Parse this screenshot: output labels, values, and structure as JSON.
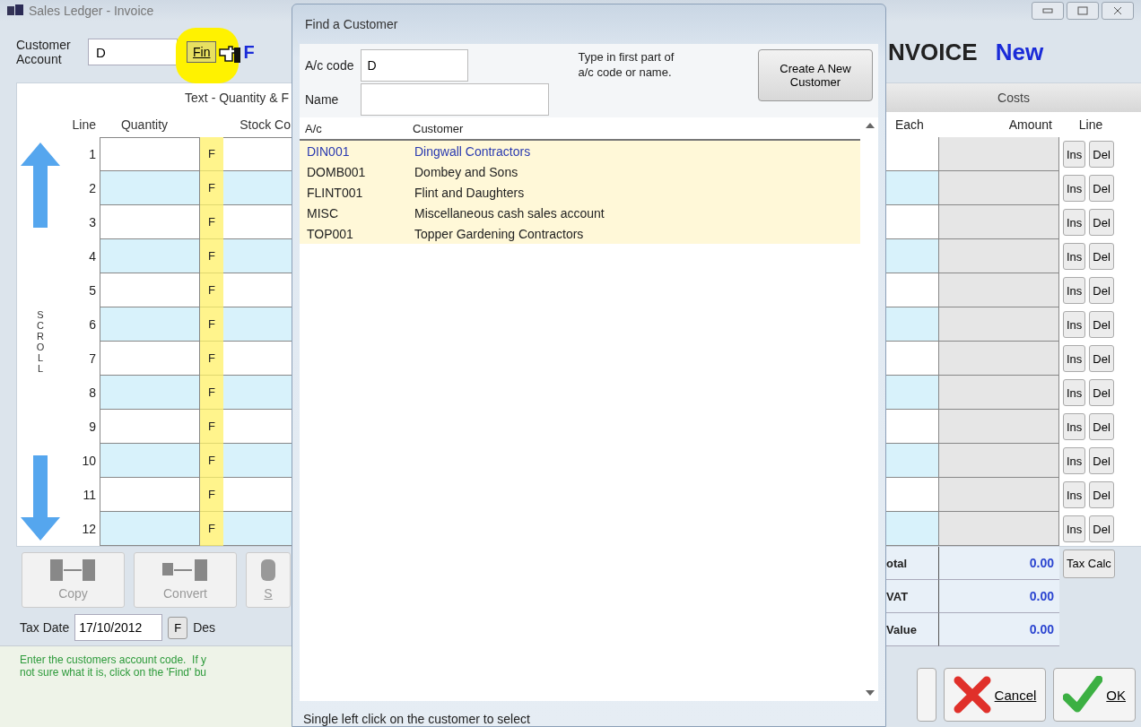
{
  "window": {
    "title": "Sales Ledger - Invoice"
  },
  "header": {
    "account_label": "Customer Account",
    "account_value": "D",
    "find_button": "Fin",
    "find_highlighted": true,
    "cut_label": "F",
    "doc_title": "NVOICE",
    "doc_status": "New"
  },
  "lines_panel": {
    "heading": "Text - Quantity & F",
    "columns": [
      "Line",
      "Quantity",
      "Stock Co"
    ],
    "scroll_label": "SCROLL"
  },
  "costs_panel": {
    "heading": "Costs",
    "columns": [
      "Each",
      "Amount",
      "Line"
    ]
  },
  "rows": [
    {
      "line": "1",
      "find": "F",
      "ins": "Ins",
      "del": "Del"
    },
    {
      "line": "2",
      "find": "F",
      "ins": "Ins",
      "del": "Del"
    },
    {
      "line": "3",
      "find": "F",
      "ins": "Ins",
      "del": "Del"
    },
    {
      "line": "4",
      "find": "F",
      "ins": "Ins",
      "del": "Del"
    },
    {
      "line": "5",
      "find": "F",
      "ins": "Ins",
      "del": "Del"
    },
    {
      "line": "6",
      "find": "F",
      "ins": "Ins",
      "del": "Del"
    },
    {
      "line": "7",
      "find": "F",
      "ins": "Ins",
      "del": "Del"
    },
    {
      "line": "8",
      "find": "F",
      "ins": "Ins",
      "del": "Del"
    },
    {
      "line": "9",
      "find": "F",
      "ins": "Ins",
      "del": "Del"
    },
    {
      "line": "10",
      "find": "F",
      "ins": "Ins",
      "del": "Del"
    },
    {
      "line": "11",
      "find": "F",
      "ins": "Ins",
      "del": "Del"
    },
    {
      "line": "12",
      "find": "F",
      "ins": "Ins",
      "del": "Del"
    }
  ],
  "action_buttons": [
    {
      "label": "Copy",
      "kind": "copy"
    },
    {
      "label": "Convert",
      "kind": "convert"
    },
    {
      "label": "S",
      "kind": "cut"
    }
  ],
  "tax_date": {
    "label": "Tax Date",
    "value": "17/10/2012",
    "button": "F",
    "next_label": "Des"
  },
  "hint_lines": [
    "Enter the customers account code.  If y",
    "not sure what it is, click on the 'Find' bu"
  ],
  "totals": [
    {
      "label": "otal",
      "value": "0.00",
      "button": "Tax Calc"
    },
    {
      "label": "VAT",
      "value": "0.00"
    },
    {
      "label": "Value",
      "value": "0.00"
    }
  ],
  "footer_buttons": [
    {
      "kind": "blank"
    },
    {
      "label": "Cancel",
      "kind": "cancel"
    },
    {
      "label": "OK",
      "kind": "ok"
    }
  ],
  "dialog": {
    "title": "Find a Customer",
    "code_label": "A/c code",
    "code_value": "D",
    "name_label": "Name",
    "help": "Type in first part of a/c code or name.",
    "create_button": "Create A New Customer",
    "columns": [
      "A/c",
      "Customer"
    ],
    "customers": [
      {
        "code": "DIN001",
        "name": "Dingwall Contractors",
        "selected": true
      },
      {
        "code": "DOMB001",
        "name": "Dombey and Sons",
        "selected": false
      },
      {
        "code": "FLINT001",
        "name": "Flint and Daughters",
        "selected": false
      },
      {
        "code": "MISC",
        "name": "Miscellaneous cash sales account",
        "selected": false
      },
      {
        "code": "TOP001",
        "name": "Topper Gardening Contractors",
        "selected": false
      }
    ],
    "status": "Single left click on the customer to select"
  }
}
